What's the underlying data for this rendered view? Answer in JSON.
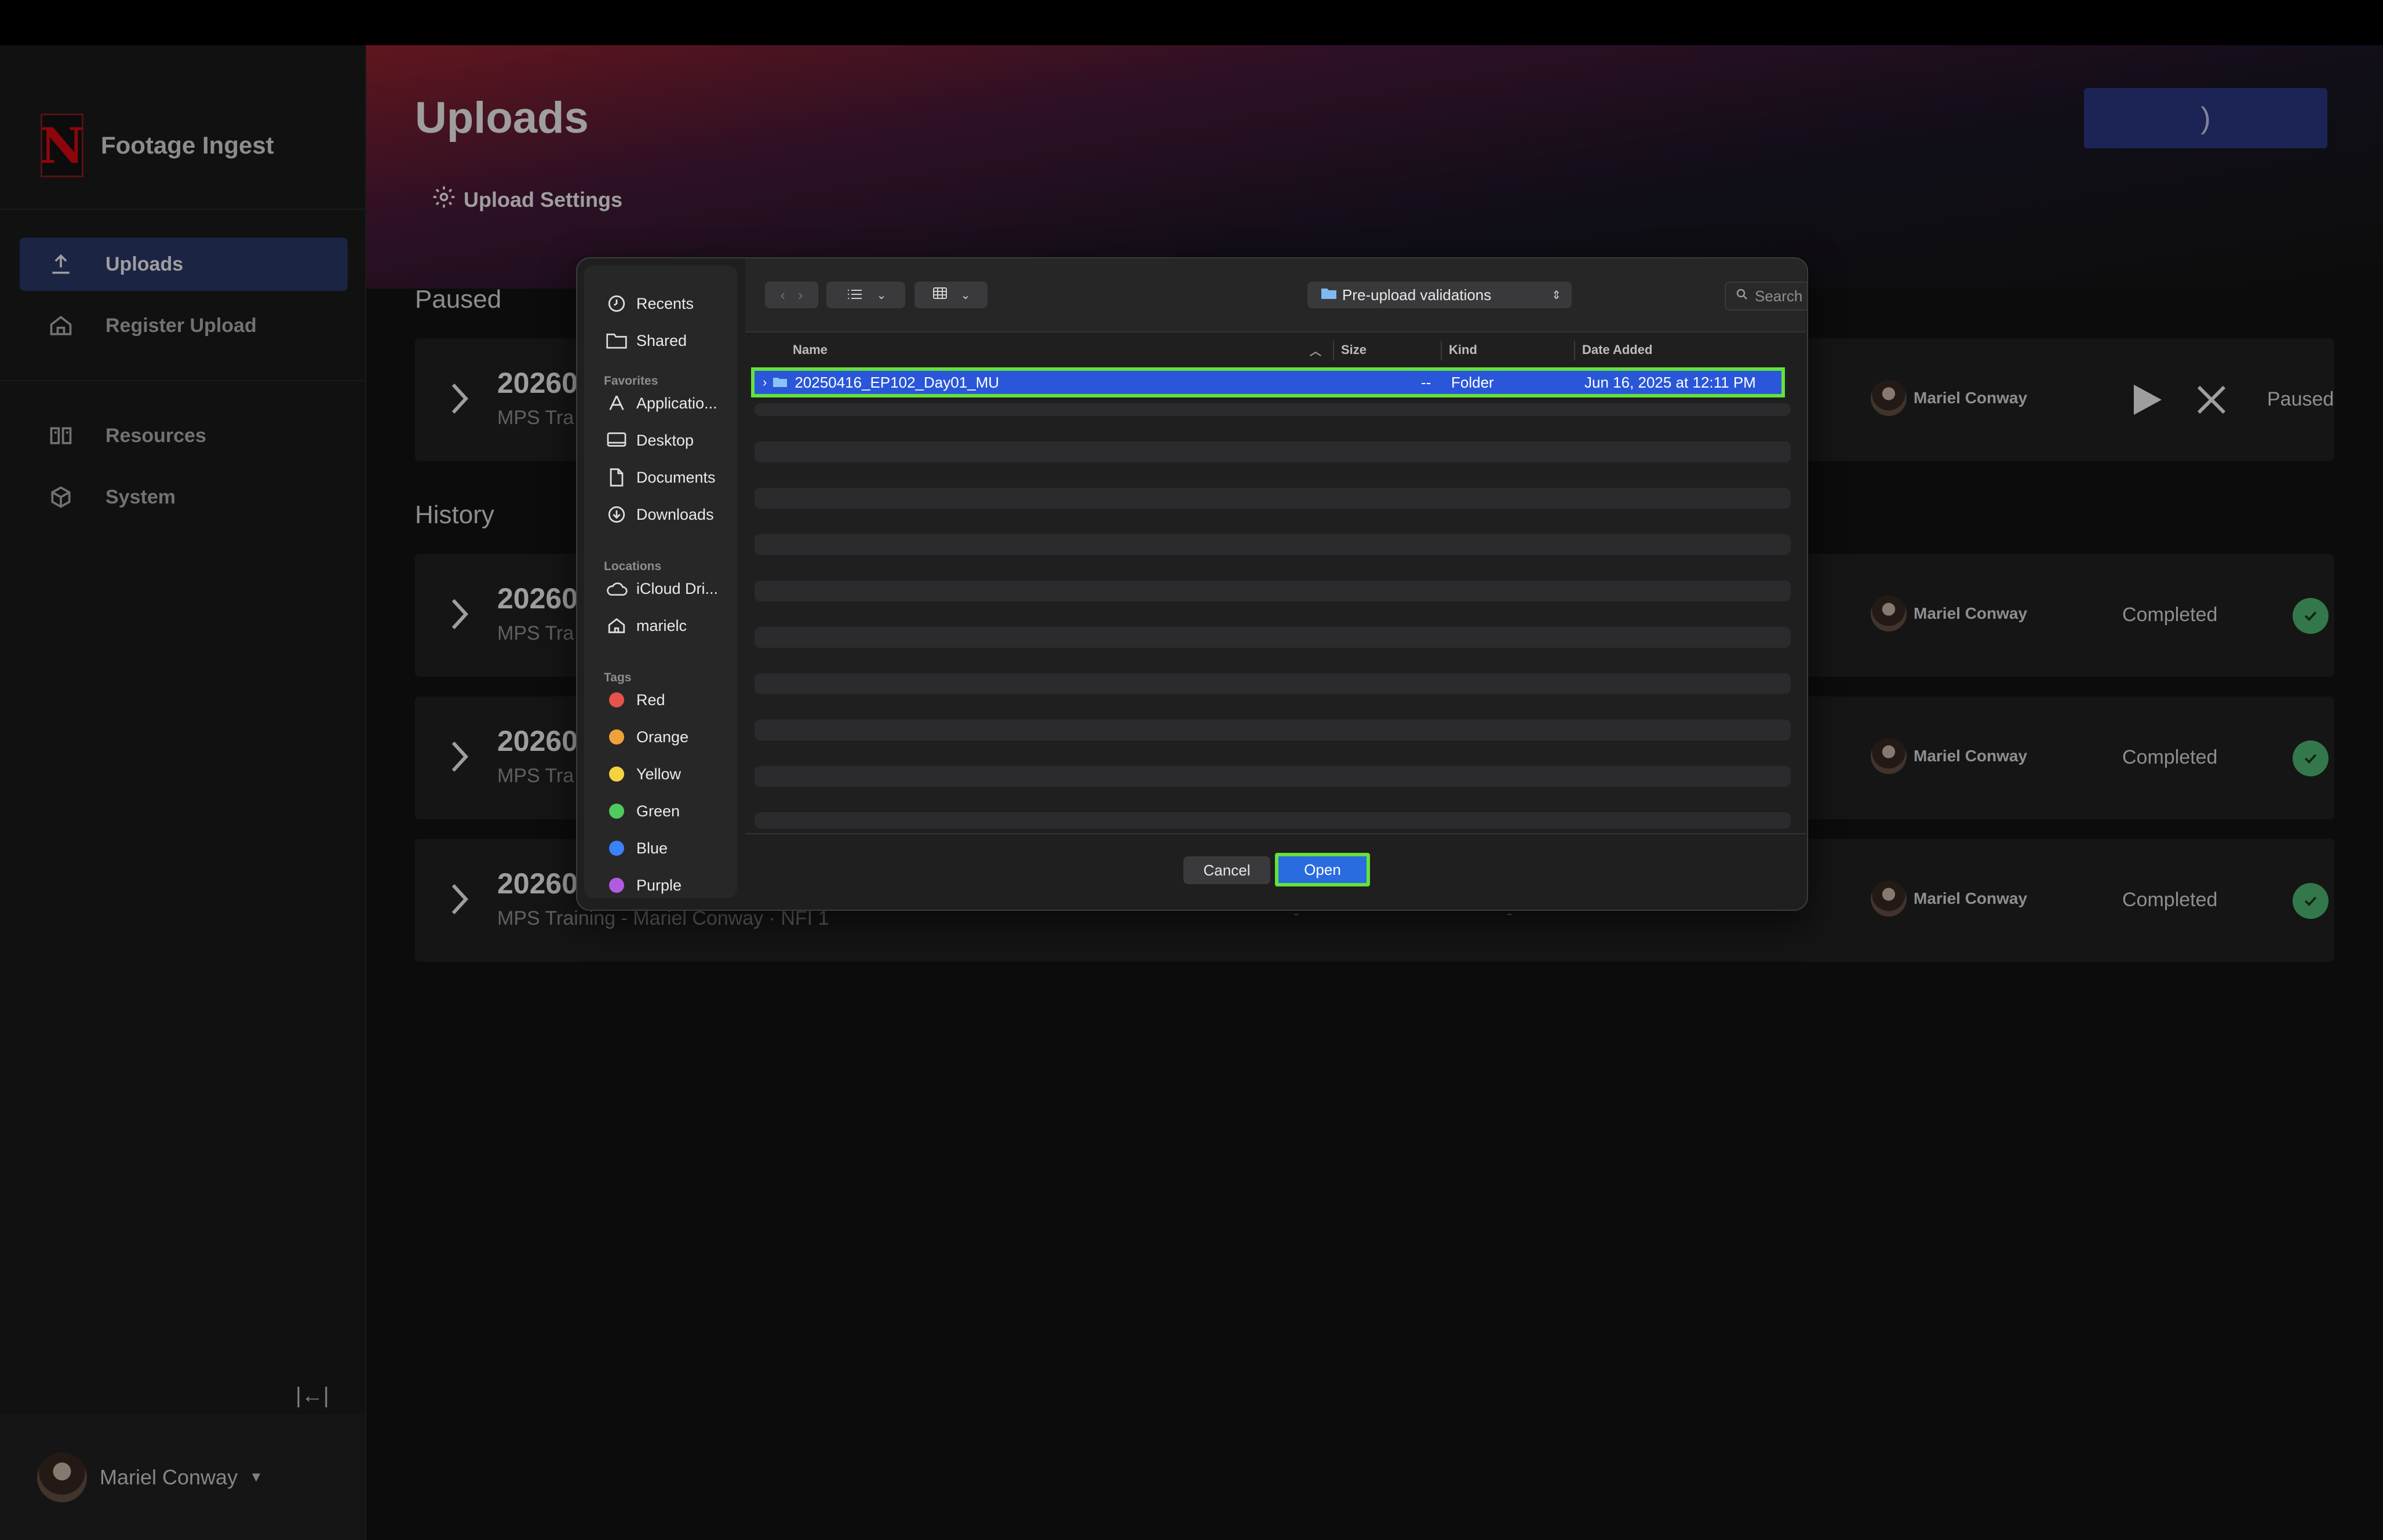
{
  "app": {
    "brand": "Footage Ingest",
    "logo_letter": "N",
    "accent": "#e50914",
    "nav": [
      {
        "label": "Uploads",
        "icon": "upload-icon",
        "active": true
      },
      {
        "label": "Register Upload",
        "icon": "home-icon",
        "active": false
      },
      {
        "label": "Resources",
        "icon": "book-icon",
        "active": false
      },
      {
        "label": "System",
        "icon": "cube-icon",
        "active": false
      }
    ],
    "user_name": "Mariel Conway",
    "collapse_glyph": "|←|"
  },
  "page": {
    "title": "Uploads",
    "settings_label": "Upload Settings",
    "top_button_glyph": ")",
    "section_paused": "Paused",
    "section_history": "History"
  },
  "uploads": [
    {
      "title": "20260",
      "subtitle": "MPS Tra",
      "user": "Mariel Conway",
      "status": "Paused"
    },
    {
      "title": "20260",
      "subtitle": "MPS Tra",
      "user": "Mariel Conway",
      "status": "Completed"
    },
    {
      "title": "20260",
      "subtitle": "MPS Tra",
      "user": "Mariel Conway",
      "status": "Completed"
    },
    {
      "title": "20260",
      "subtitle": "MPS Training - Mariel Conway · NFI 1",
      "user": "Mariel Conway",
      "status": "Completed"
    }
  ],
  "dialog": {
    "sidebar": {
      "items_top": [
        "Recents",
        "Shared"
      ],
      "favorites_heading": "Favorites",
      "favorites": [
        "Applicatio...",
        "Desktop",
        "Documents",
        "Downloads"
      ],
      "locations_heading": "Locations",
      "locations": [
        "iCloud Dri...",
        "marielc"
      ],
      "tags_heading": "Tags",
      "tags": [
        {
          "label": "Red",
          "color": "#e5534b"
        },
        {
          "label": "Orange",
          "color": "#f0a23a"
        },
        {
          "label": "Yellow",
          "color": "#f4d33f"
        },
        {
          "label": "Green",
          "color": "#4fca5e"
        },
        {
          "label": "Blue",
          "color": "#3a82f7"
        },
        {
          "label": "Purple",
          "color": "#b25be0"
        }
      ]
    },
    "path": "Pre-upload validations",
    "search_placeholder": "Search",
    "columns": {
      "name": "Name",
      "size": "Size",
      "kind": "Kind",
      "date": "Date Added"
    },
    "selected_row": {
      "name": "20250416_EP102_Day01_MU",
      "size": "--",
      "kind": "Folder",
      "date": "Jun 16, 2025 at 12:11 PM"
    },
    "cancel_label": "Cancel",
    "open_label": "Open",
    "highlight_color": "#64e23a"
  },
  "bg_dashes": [
    "-",
    "-"
  ]
}
